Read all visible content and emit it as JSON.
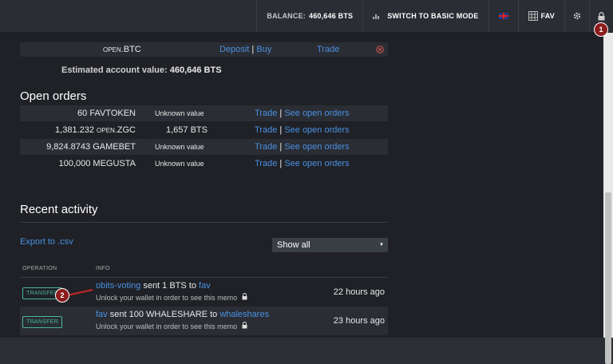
{
  "topbar": {
    "balance_label": "BALANCE:",
    "balance_value": "460,646 BTS",
    "basic_mode": "SWITCH TO BASIC MODE",
    "fav": "FAV",
    "settings_icon": "gear-icon",
    "lock_icon": "lock-icon"
  },
  "asset_row": {
    "prefix": "OPEN",
    "asset": ".BTC",
    "deposit": "Deposit",
    "sep": "|",
    "buy": "Buy",
    "trade": "Trade"
  },
  "estimated": {
    "label": "Estimated account value:",
    "value": "460,646 BTS"
  },
  "open_orders": {
    "title": "Open orders",
    "rows": [
      {
        "amount": "60 FAVTOKEN",
        "prefix": "",
        "value": "Unknown value",
        "trade": "Trade",
        "sep": "|",
        "see": "See open orders"
      },
      {
        "amount": "1,381.232 ",
        "prefix": "OPEN",
        "suffix": ".ZGC",
        "value": "1,657 BTS",
        "trade": "Trade",
        "sep": "|",
        "see": "See open orders"
      },
      {
        "amount": "9,824.8743 GAMEBET",
        "prefix": "",
        "value": "Unknown value",
        "trade": "Trade",
        "sep": "|",
        "see": "See open orders"
      },
      {
        "amount": "100,000 MEGUSTA",
        "prefix": "",
        "value": "Unknown value",
        "trade": "Trade",
        "sep": "|",
        "see": "See open orders"
      }
    ]
  },
  "recent_activity": {
    "title": "Recent activity",
    "export": "Export to .csv",
    "filter": "Show all",
    "col_operation": "OPERATION",
    "col_info": "INFO",
    "rows": [
      {
        "badge": "TRANSFER",
        "from": "obits-voting",
        "text": " sent 1 BTS to ",
        "to": "fav",
        "memo": "Unlock your wallet in order to see this memo",
        "time": "22 hours ago"
      },
      {
        "badge": "TRANSFER",
        "from": "fav",
        "text": " sent 100 WHALESHARE to ",
        "to": "whaleshares",
        "memo": "Unlock your wallet in order to see this memo",
        "time": "23 hours ago"
      }
    ]
  },
  "markers": {
    "one": "1",
    "two": "2"
  },
  "colors": {
    "accent_link": "#4a90e2",
    "badge": "#47b59c",
    "marker": "#8b1d1d"
  }
}
